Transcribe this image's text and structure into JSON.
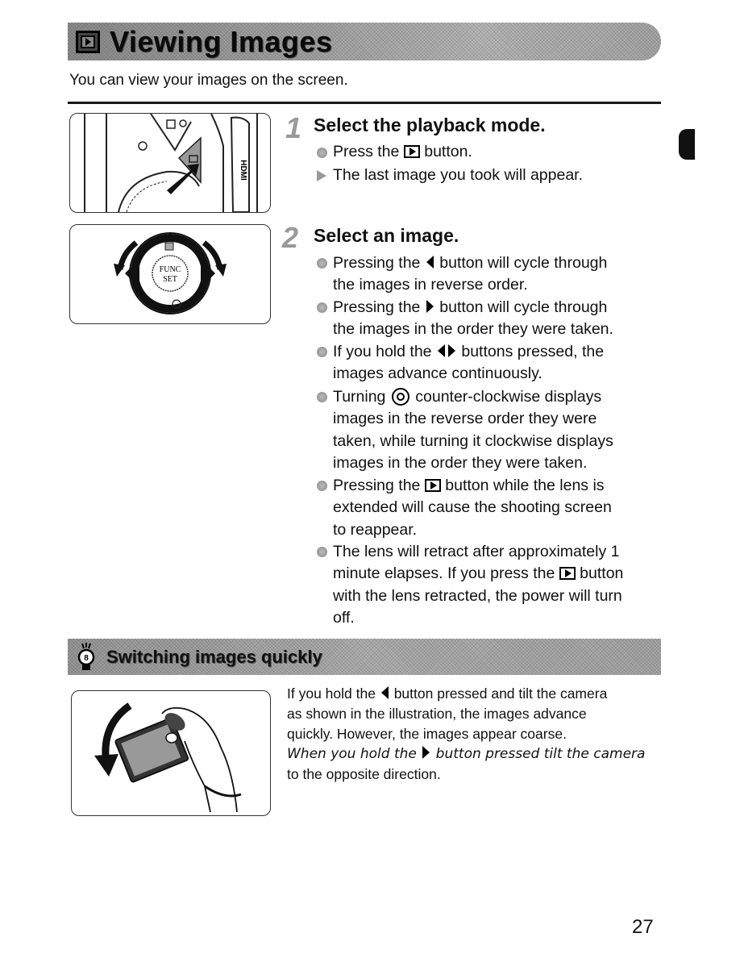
{
  "header": {
    "title": "Viewing Images",
    "title_icon": "playback-icon",
    "intro": "You can view your images on the screen."
  },
  "steps": [
    {
      "number": "1",
      "title": "Select the playback mode.",
      "items": [
        {
          "type": "bullet",
          "parts": [
            "Press the ",
            "[playback-icon]",
            " button."
          ]
        },
        {
          "type": "result",
          "parts": [
            "The last image you took will appear."
          ]
        }
      ]
    },
    {
      "number": "2",
      "title": "Select an image.",
      "items": [
        {
          "type": "bullet",
          "lines": [
            "Pressing the [left] button will cycle through",
            "the images in reverse order."
          ]
        },
        {
          "type": "bullet",
          "lines": [
            "Pressing the [right] button will cycle through",
            "the images in the order they were taken."
          ]
        },
        {
          "type": "bullet",
          "lines": [
            "If you hold the [left][right] buttons pressed, the",
            "images advance continuously."
          ]
        },
        {
          "type": "bullet",
          "lines": [
            "Turning [dial] counter-clockwise displays",
            "images in the reverse order they were",
            "taken, while turning it clockwise displays",
            "images in the order they were taken."
          ]
        },
        {
          "type": "bullet",
          "lines": [
            "Pressing the [playback] button while the lens is",
            "extended will cause the shooting screen",
            "to reappear."
          ]
        },
        {
          "type": "bullet",
          "lines": [
            "The lens will retract after approximately 1",
            "minute elapses. If you press the [playback] button",
            "with the lens retracted, the power will turn",
            "off."
          ]
        }
      ]
    }
  ],
  "text": {
    "s1b1a": "Press the",
    "s1b1b": "button.",
    "s1r1": "The last image you took will appear.",
    "s2b1a": "Pressing the",
    "s2b1b": "button will cycle through",
    "s2b1c": "the images in reverse order.",
    "s2b2a": "Pressing the",
    "s2b2b": "button will cycle through",
    "s2b2c": "the images in the order they were taken.",
    "s2b3a": "If you hold the",
    "s2b3b": "buttons pressed, the",
    "s2b3c": "images advance continuously.",
    "s2b4a": "Turning",
    "s2b4b": "counter-clockwise displays",
    "s2b4c": "images in the reverse order they were",
    "s2b4d": "taken, while turning it clockwise displays",
    "s2b4e": "images in the order they were taken.",
    "s2b5a": "Pressing the",
    "s2b5b": "button while the lens is",
    "s2b5c": "extended will cause the shooting screen",
    "s2b5d": "to reappear.",
    "s2b6a": "The lens will retract after approximately 1",
    "s2b6b": "minute elapses. If you press the",
    "s2b6c": "button",
    "s2b6d": "with the lens retracted, the power will turn",
    "s2b6e": "off."
  },
  "tip": {
    "title": "Switching images quickly",
    "icon": "lightbulb-icon",
    "l1a": "If you hold the",
    "l1b": "button pressed and tilt the camera",
    "l2": "as shown in the illustration, the images advance",
    "l3": "quickly. However, the images appear coarse.",
    "l4a": "When you hold the",
    "l4b": "button pressed tilt the camera",
    "l5": "to the opposite direction."
  },
  "illustrations": {
    "camera_top_label": "HDMI",
    "control_dial_center": "FUNC SET"
  },
  "page_number": "27"
}
